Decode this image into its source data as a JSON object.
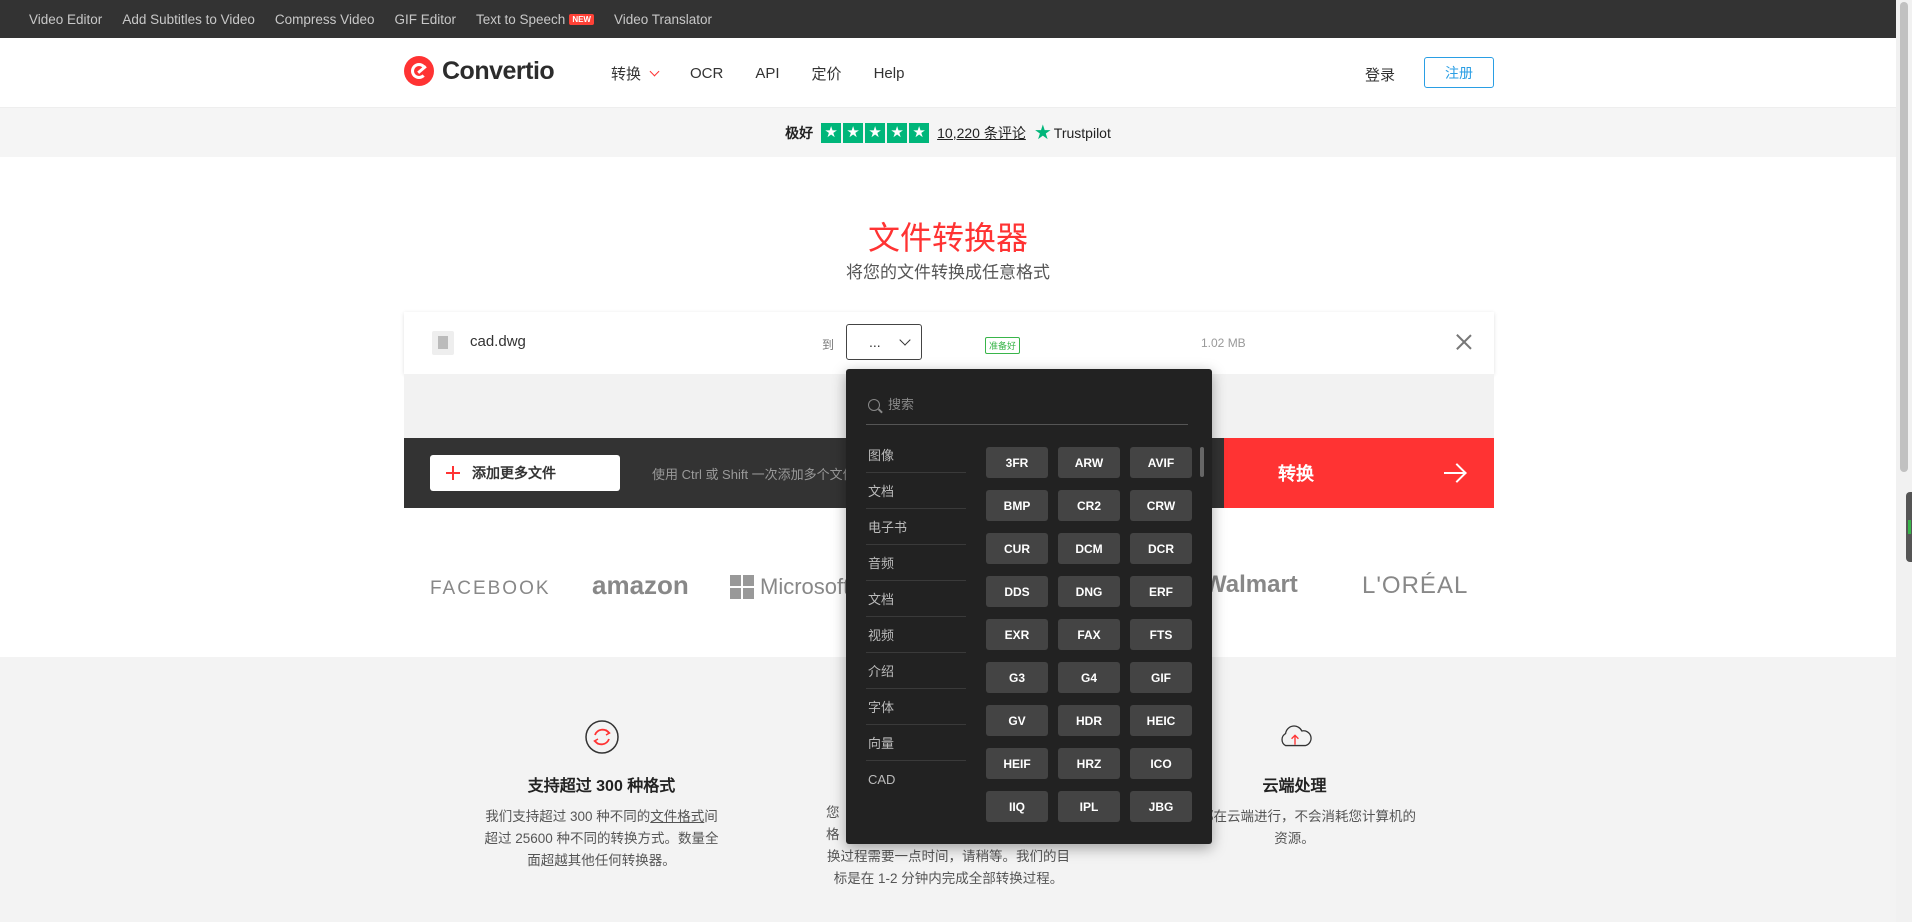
{
  "topbar": {
    "links": [
      "Video Editor",
      "Add Subtitles to Video",
      "Compress Video",
      "GIF Editor",
      "Text to Speech",
      "Video Translator"
    ],
    "new_badge": "NEW"
  },
  "header": {
    "logo_text": "Convertio",
    "nav": [
      "转换",
      "OCR",
      "API",
      "定价",
      "Help"
    ],
    "login": "登录",
    "signup": "注册"
  },
  "trustpilot": {
    "label": "极好",
    "count": "10,220 条评论",
    "brand": "Trustpilot"
  },
  "hero": {
    "title": "文件转换器",
    "subtitle": "将您的文件转换成任意格式"
  },
  "file": {
    "name": "cad.dwg",
    "to_label": "到",
    "selected_format": "...",
    "status": "准备好",
    "size": "1.02 MB"
  },
  "actions": {
    "add_more": "添加更多文件",
    "hint": "使用 Ctrl 或 Shift 一次添加多个文件",
    "convert": "转换"
  },
  "brands": [
    "FACEBOOK",
    "amazon",
    "Microsoft",
    "Walmart",
    "L'ORÉAL"
  ],
  "dropdown": {
    "search_placeholder": "搜索",
    "categories": [
      "图像",
      "文档",
      "电子书",
      "音频",
      "文档",
      "视频",
      "介绍",
      "字体",
      "向量",
      "CAD"
    ],
    "formats": [
      "3FR",
      "ARW",
      "AVIF",
      "BMP",
      "CR2",
      "CRW",
      "CUR",
      "DCM",
      "DCR",
      "DDS",
      "DNG",
      "ERF",
      "EXR",
      "FAX",
      "FTS",
      "G3",
      "G4",
      "GIF",
      "GV",
      "HDR",
      "HEIC",
      "HEIF",
      "HRZ",
      "ICO",
      "IIQ",
      "IPL",
      "JBG"
    ]
  },
  "features": {
    "left": {
      "title": "支持超过 300 种格式",
      "text_pre": "我们支持超过 300 种不同的",
      "text_link": "文件格式",
      "text_post": "间超过 25600 种不同的转换方式。数量全面超越其他任何转换器。"
    },
    "middle": {
      "line1": "您",
      "line2": "格",
      "text": "换过程需要一点时间，请稍等。我们的目标是在 1-2 分钟内完成全部转换过程。"
    },
    "right": {
      "title": "云端处理",
      "text": "转换都在云端进行，不会消耗您计算机的资源。"
    }
  },
  "colors": {
    "brand_red": "#ff3333",
    "trustpilot_green": "#00b67a",
    "signup_blue": "#2a9ee4",
    "dark_bar": "#333333",
    "dropdown_bg": "#222222"
  }
}
